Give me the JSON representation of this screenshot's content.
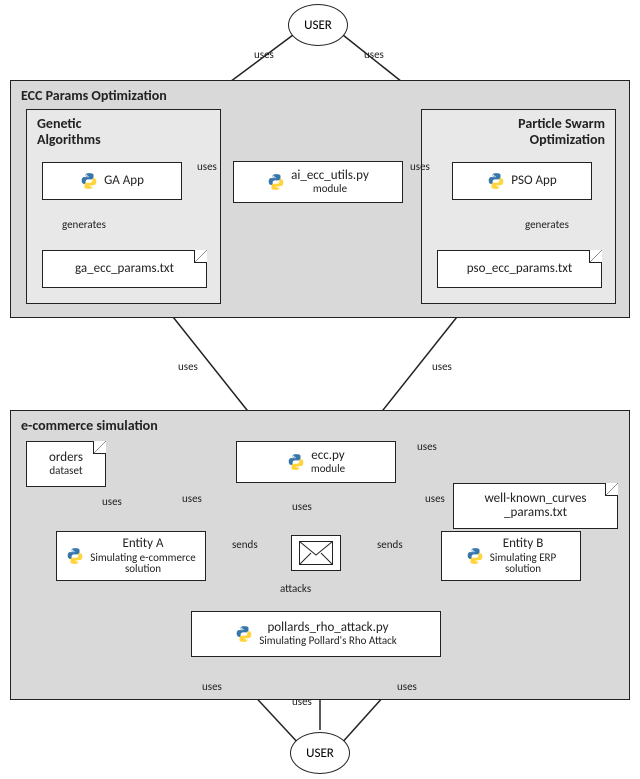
{
  "users": {
    "top": "USER",
    "bottom": "USER"
  },
  "panels": {
    "ecc_opt": {
      "title": "ECC Params Optimization"
    },
    "ecom": {
      "title": "e-commerce simulation"
    }
  },
  "sub_panels": {
    "ga": {
      "title": "Genetic\nAlgorithms"
    },
    "pso": {
      "title": "Particle Swarm\nOptimization"
    }
  },
  "nodes": {
    "ga_app": {
      "title": "GA App"
    },
    "pso_app": {
      "title": "PSO App"
    },
    "ai_utils": {
      "title": "ai_ecc_utils.py",
      "sub": "module"
    },
    "ga_params": {
      "title": "ga_ecc_params.txt"
    },
    "pso_params": {
      "title": "pso_ecc_params.txt"
    },
    "orders": {
      "title": "orders",
      "sub": "dataset"
    },
    "ecc_py": {
      "title": "ecc.py",
      "sub": "module"
    },
    "curves": {
      "title": "well-known_curves\n_params.txt"
    },
    "entity_a": {
      "title": "Entity A",
      "sub": "Simulating e-commerce\nsolution"
    },
    "entity_b": {
      "title": "Entity B",
      "sub": "Simulating ERP\nsolution"
    },
    "pollard": {
      "title": "pollards_rho_attack.py",
      "sub": "Simulating Pollard's Rho Attack"
    }
  },
  "edges": {
    "uses": "uses",
    "generates": "generates",
    "sends": "sends",
    "attacks": "attacks"
  }
}
